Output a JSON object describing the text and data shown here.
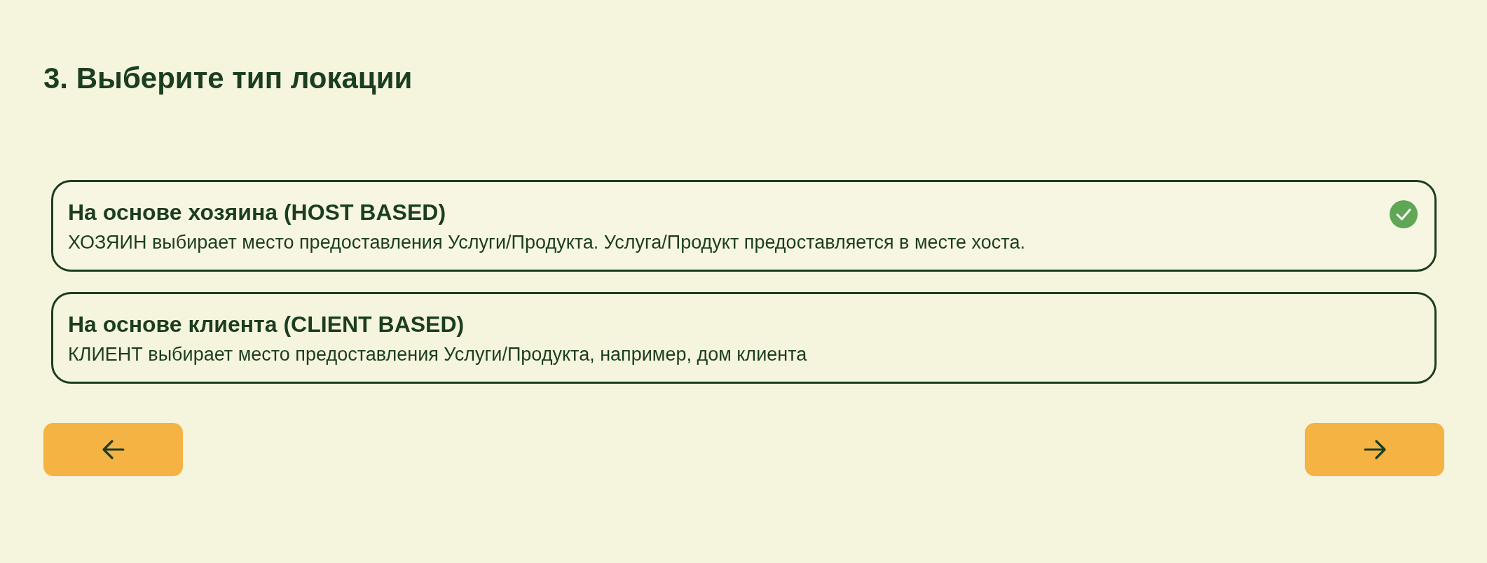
{
  "title": "3. Выберите тип локации",
  "options": [
    {
      "title": "На основе хозяина (HOST BASED)",
      "description": "ХОЗЯИН выбирает место предоставления Услуги/Продукта. Услуга/Продукт предоставляется в месте хоста.",
      "selected": true
    },
    {
      "title": "На основе клиента (CLIENT BASED)",
      "description": "КЛИЕНТ выбирает место предоставления Услуги/Продукта, например, дом клиента",
      "selected": false
    }
  ]
}
